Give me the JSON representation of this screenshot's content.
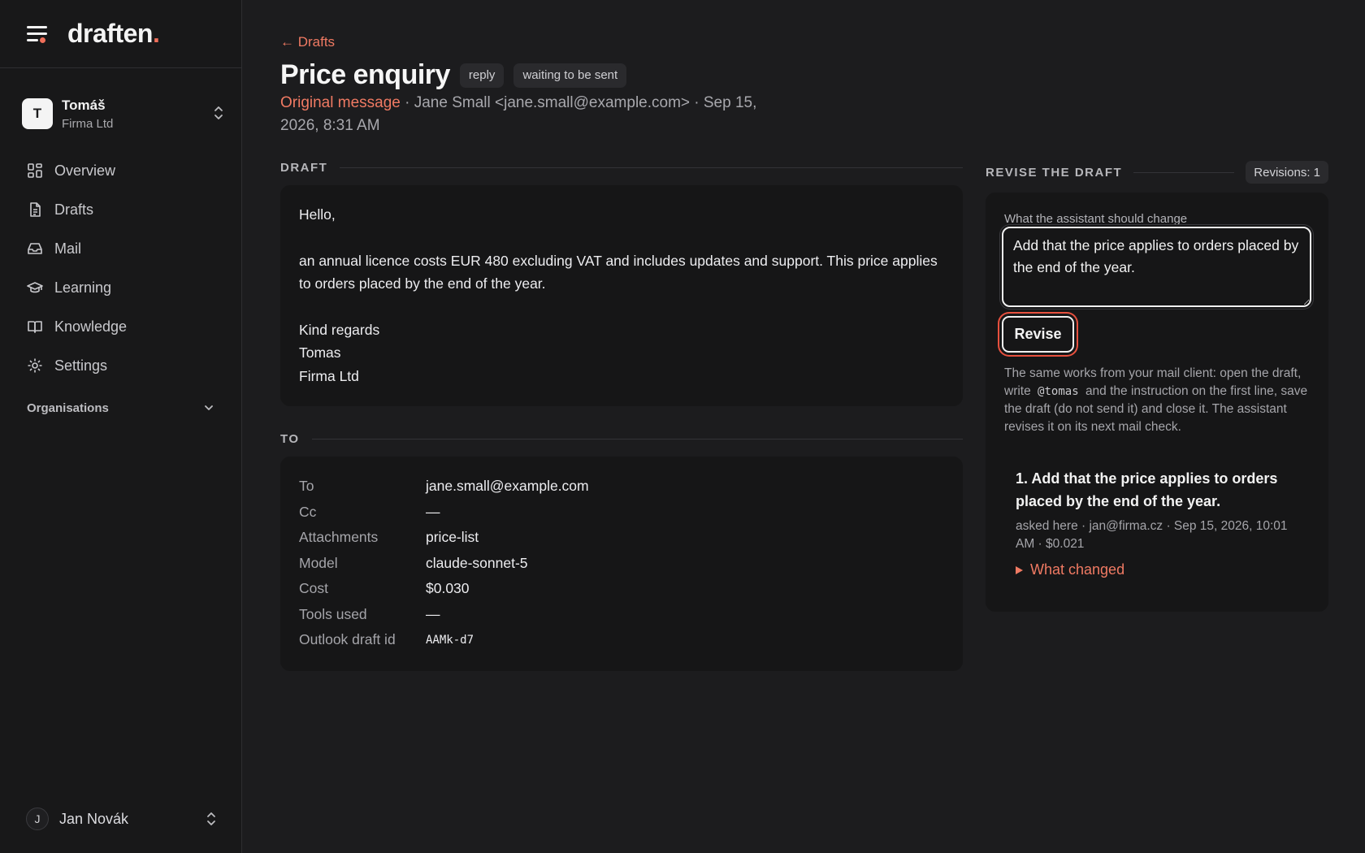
{
  "brand": {
    "name": "draften",
    "dot": "."
  },
  "org": {
    "initial": "T",
    "user": "Tomáš",
    "company": "Firma Ltd"
  },
  "nav": {
    "items": [
      {
        "label": "Overview",
        "icon": "grid-icon"
      },
      {
        "label": "Drafts",
        "icon": "document-icon"
      },
      {
        "label": "Mail",
        "icon": "inbox-icon"
      },
      {
        "label": "Learning",
        "icon": "graduation-cap-icon"
      },
      {
        "label": "Knowledge",
        "icon": "book-icon"
      },
      {
        "label": "Settings",
        "icon": "gear-icon"
      }
    ],
    "section_label": "Organisations"
  },
  "account": {
    "initial": "J",
    "name": "Jan Novák"
  },
  "page": {
    "back_label": "← Drafts",
    "title": "Price enquiry",
    "badges": [
      "reply",
      "waiting to be sent"
    ],
    "original_link": "Original message",
    "meta_rest": " · Jane Small <jane.small@example.com> · Sep 15, 2026, 8:31 AM"
  },
  "draft": {
    "section_label": "DRAFT",
    "greeting": "Hello,",
    "body": "an annual licence costs EUR 480 excluding VAT and includes updates and support. This price applies to orders placed by the end of the year.",
    "closing": "Kind regards",
    "sign_name": "Tomas",
    "sign_company": "Firma Ltd"
  },
  "recipients": {
    "section_label": "TO",
    "rows": [
      {
        "key": "To",
        "value": "jane.small@example.com"
      },
      {
        "key": "Cc",
        "value": "—"
      },
      {
        "key": "Attachments",
        "value": "price-list"
      },
      {
        "key": "Model",
        "value": "claude-sonnet-5"
      },
      {
        "key": "Cost",
        "value": "$0.030"
      },
      {
        "key": "Tools used",
        "value": "—"
      },
      {
        "key": "Outlook draft id",
        "value": "AAMk-d7"
      }
    ]
  },
  "revise": {
    "section_label": "REVISE THE DRAFT",
    "count_label": "Revisions: 1",
    "field_label": "What the assistant should change",
    "field_value": "Add that the price applies to orders placed by the end of the year.",
    "button_label": "Revise",
    "help_before": "The same works from your mail client: open the draft, write",
    "help_code": "@tomas",
    "help_after": "and the instruction on the first line, save the draft (do not send it) and close it. The assistant revises it on its next mail check.",
    "history": [
      {
        "text": "1. Add that the price applies to orders placed by the end of the year.",
        "meta": "asked here · jan@firma.cz · Sep 15, 2026, 10:01 AM · $0.021",
        "details_label": "What changed"
      }
    ]
  },
  "colors": {
    "accent": "#f07a63",
    "focus_ring": "#e7503e",
    "background": "#1c1c1e",
    "card": "#161617"
  }
}
